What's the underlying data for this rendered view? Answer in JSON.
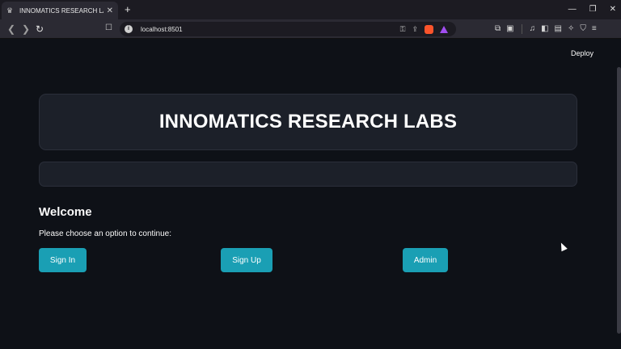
{
  "browser": {
    "tab_title": "INNOMATICS RESEARCH LABS -",
    "tab_favicon": "streamlit-crown-icon",
    "new_tab_label": "+",
    "url": "localhost:8501"
  },
  "app": {
    "deploy_label": "Deploy",
    "header_title": "INNOMATICS RESEARCH LABS",
    "welcome_heading": "Welcome",
    "prompt_text": "Please choose an option to continue:",
    "buttons": {
      "sign_in": "Sign In",
      "sign_up": "Sign Up",
      "admin": "Admin"
    }
  },
  "colors": {
    "background": "#0e1117",
    "card": "#1c2029",
    "button": "#1a9fb4"
  }
}
